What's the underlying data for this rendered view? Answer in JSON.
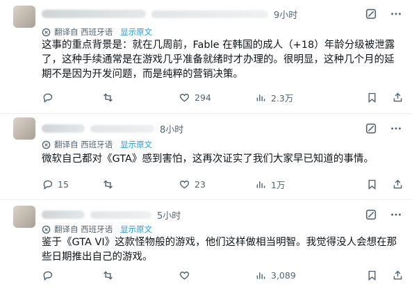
{
  "posts": [
    {
      "time": "9小时",
      "translated_from": "翻译自 西班牙语",
      "show_original": "显示原文",
      "text": "这事的重点背景是：就在几周前，Fable 在韩国的成人（+18）年龄分级被泄露了，这种手续通常是在游戏几乎准备就绪时才办理的。很明显，这种几个月的延期不是因为开发问题，而是纯粹的营销决策。",
      "replies": "",
      "reposts": "",
      "likes": "294",
      "views": "2.3万"
    },
    {
      "time": "8小时",
      "translated_from": "翻译自 西班牙语",
      "show_original": "显示原文",
      "text": "微软自己都对《GTA》感到害怕，这再次证实了我们大家早已知道的事情。",
      "replies": "15",
      "reposts": "",
      "likes": "23",
      "views": "1万"
    },
    {
      "time": "5小时",
      "translated_from": "翻译自 西班牙语",
      "show_original": "显示原文",
      "text": "鉴于《GTA VI》这款怪物般的游戏，他们这样做相当明智。我觉得没人会想在那些日期推出自己的游戏。",
      "replies": "",
      "reposts": "",
      "likes": "",
      "views": "3,089"
    }
  ],
  "icons": {
    "grok": "grok-icon",
    "more": "more-icon",
    "translate": "translate-icon",
    "reply": "reply-icon",
    "repost": "repost-icon",
    "like": "like-icon",
    "views": "views-icon",
    "bookmark": "bookmark-icon",
    "share": "share-icon"
  },
  "colors": {
    "link": "#1d9bf0",
    "secondary": "#536471",
    "text": "#0f1419"
  }
}
